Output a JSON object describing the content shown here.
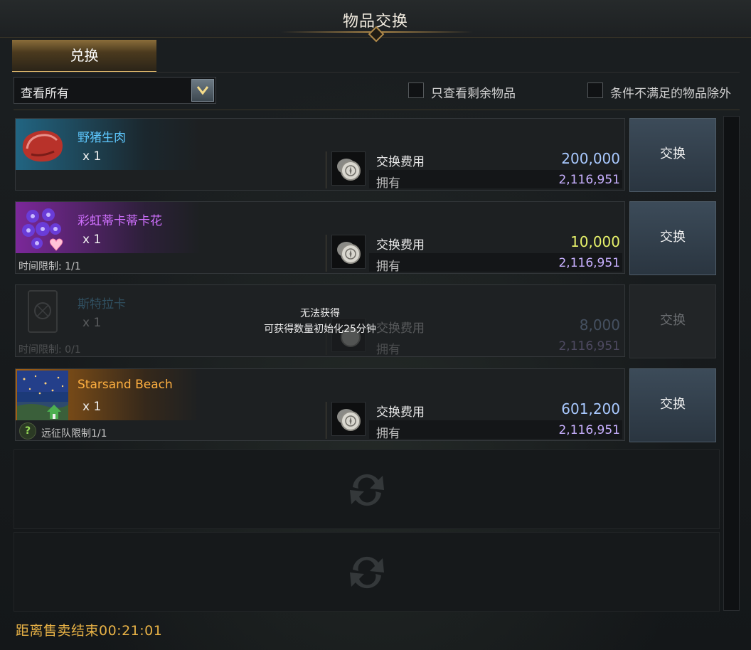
{
  "window": {
    "title": "物品交换"
  },
  "tabs": [
    {
      "label": "兑换",
      "active": true
    }
  ],
  "filter": {
    "dropdown_value": "查看所有",
    "options": [
      {
        "label": "只查看剩余物品",
        "checked": false
      },
      {
        "label": "条件不满足的物品除外",
        "checked": false
      }
    ]
  },
  "items": [
    {
      "name": "野猪生肉",
      "name_color": "#5ec8ff",
      "quantity": "x 1",
      "limit": "",
      "fee_label": "交换费用",
      "fee": "200,000",
      "fee_color": "#a9c9ff",
      "own_label": "拥有",
      "own": "2,116,951",
      "button": "交换",
      "available": true
    },
    {
      "name": "彩虹蒂卡蒂卡花",
      "name_color": "#d070ff",
      "quantity": "x 1",
      "limit": "时间限制: 1/1",
      "fee_label": "交换费用",
      "fee": "10,000",
      "fee_color": "#e6f06a",
      "own_label": "拥有",
      "own": "2,116,951",
      "button": "交换",
      "available": true
    },
    {
      "name": "斯特拉卡",
      "name_color": "#5ec8ff",
      "quantity": "x 1",
      "limit": "时间限制: 0/1",
      "fee_label": "交换费用",
      "fee": "8,000",
      "fee_color": "#a9c9ff",
      "own_label": "拥有",
      "own": "2,116,951",
      "button": "交换",
      "available": false,
      "unavailable_title": "无法获得",
      "unavailable_note": "可获得数量初始化25分钟"
    },
    {
      "name": "Starsand Beach",
      "name_color": "#ffb040",
      "quantity": "x 1",
      "limit": "远征队限制1/1",
      "fee_label": "交换费用",
      "fee": "601,200",
      "fee_color": "#a9c9ff",
      "own_label": "拥有",
      "own": "2,116,951",
      "button": "交换",
      "available": true
    }
  ],
  "footer": {
    "timer": "距离售卖结束00:21:01"
  },
  "colors": {
    "accent_gold": "#e8b246",
    "owned": "#c8b0ff"
  }
}
